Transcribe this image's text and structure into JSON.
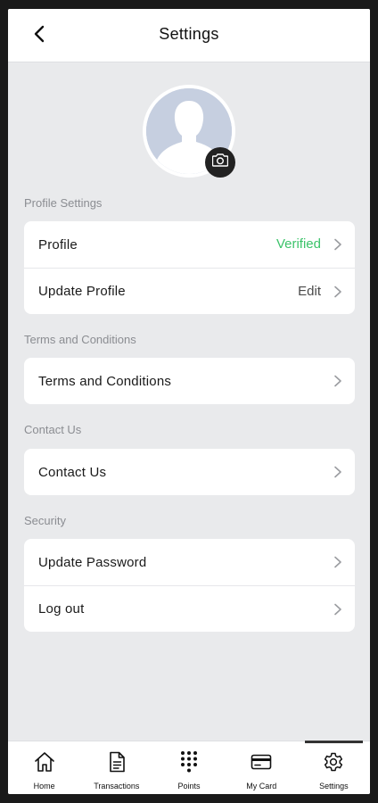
{
  "header": {
    "title": "Settings",
    "back_icon": "chevron-left-icon"
  },
  "avatar": {
    "placeholder_icon": "user-silhouette-icon",
    "camera_icon": "camera-icon"
  },
  "sections": {
    "profile": {
      "label": "Profile Settings",
      "rows": [
        {
          "label": "Profile",
          "value": "Verified",
          "value_color": "#3cc36a"
        },
        {
          "label": "Update Profile",
          "value": "Edit"
        }
      ]
    },
    "terms": {
      "label": "Terms and Conditions",
      "rows": [
        {
          "label": "Terms and Conditions"
        }
      ]
    },
    "contact": {
      "label": "Contact Us",
      "rows": [
        {
          "label": "Contact Us"
        }
      ]
    },
    "security": {
      "label": "Security",
      "rows": [
        {
          "label": "Update Password"
        },
        {
          "label": "Log out"
        }
      ]
    }
  },
  "tabbar": {
    "active": "Settings",
    "tabs": [
      {
        "label": "Home",
        "icon": "home-icon"
      },
      {
        "label": "Transactions",
        "icon": "document-icon"
      },
      {
        "label": "Points",
        "icon": "dots-grid-icon"
      },
      {
        "label": "My Card",
        "icon": "card-icon"
      },
      {
        "label": "Settings",
        "icon": "gear-icon"
      }
    ]
  },
  "colors": {
    "background": "#e9eaec",
    "card": "#ffffff",
    "verified": "#3cc36a",
    "section_label": "#8b8d92",
    "avatar_placeholder": "#c6cfe0"
  }
}
